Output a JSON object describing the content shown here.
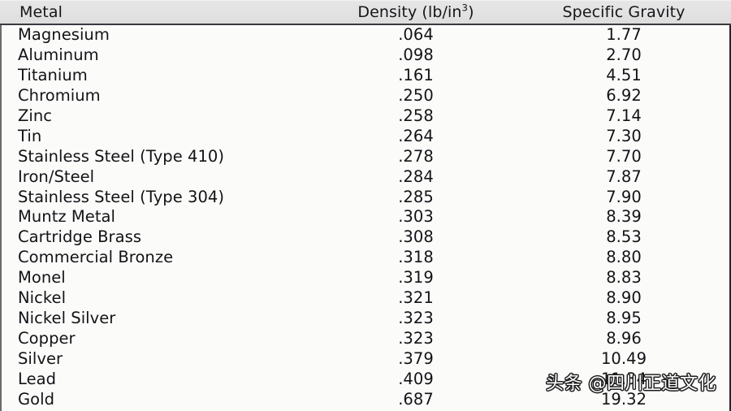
{
  "table": {
    "columns": [
      {
        "key": "metal",
        "label": "Metal",
        "align": "left"
      },
      {
        "key": "density",
        "label": "Density (lb/in",
        "label_sup": "3",
        "label_suffix": ")",
        "align": "center"
      },
      {
        "key": "specific_gravity",
        "label": "Specific Gravity",
        "align": "center"
      }
    ],
    "header": {
      "metal": "Metal",
      "density_pre": "Density (lb/in",
      "density_sup": "3",
      "density_post": ")",
      "specific_gravity": "Specific Gravity"
    },
    "rows": [
      {
        "metal": "Magnesium",
        "density": ".064",
        "specific_gravity": "1.77"
      },
      {
        "metal": "Aluminum",
        "density": ".098",
        "specific_gravity": "2.70"
      },
      {
        "metal": "Titanium",
        "density": ".161",
        "specific_gravity": "4.51"
      },
      {
        "metal": "Chromium",
        "density": ".250",
        "specific_gravity": "6.92"
      },
      {
        "metal": "Zinc",
        "density": ".258",
        "specific_gravity": "7.14"
      },
      {
        "metal": "Tin",
        "density": ".264",
        "specific_gravity": "7.30"
      },
      {
        "metal": "Stainless Steel (Type 410)",
        "density": ".278",
        "specific_gravity": "7.70"
      },
      {
        "metal": "Iron/Steel",
        "density": ".284",
        "specific_gravity": "7.87"
      },
      {
        "metal": "Stainless Steel (Type 304)",
        "density": ".285",
        "specific_gravity": "7.90"
      },
      {
        "metal": "Muntz Metal",
        "density": ".303",
        "specific_gravity": "8.39"
      },
      {
        "metal": "Cartridge Brass",
        "density": ".308",
        "specific_gravity": "8.53"
      },
      {
        "metal": "Commercial Bronze",
        "density": ".318",
        "specific_gravity": "8.80"
      },
      {
        "metal": "Monel",
        "density": ".319",
        "specific_gravity": "8.83"
      },
      {
        "metal": "Nickel",
        "density": ".321",
        "specific_gravity": "8.90"
      },
      {
        "metal": "Nickel Silver",
        "density": ".323",
        "specific_gravity": "8.95"
      },
      {
        "metal": "Copper",
        "density": ".323",
        "specific_gravity": "8.96"
      },
      {
        "metal": "Silver",
        "density": ".379",
        "specific_gravity": "10.49"
      },
      {
        "metal": "Lead",
        "density": ".409",
        "specific_gravity": "11.34"
      },
      {
        "metal": "Gold",
        "density": ".687",
        "specific_gravity": "19.32"
      }
    ]
  },
  "watermark": {
    "text": "头条 @四川正道文化"
  },
  "colors": {
    "header_background": "#e2e2e2",
    "body_background": "#fbfbfa",
    "header_rule": "#3a3a40",
    "text": "#131317",
    "watermark_fill": "#ffffff",
    "watermark_outline": "#1c1c1c"
  }
}
